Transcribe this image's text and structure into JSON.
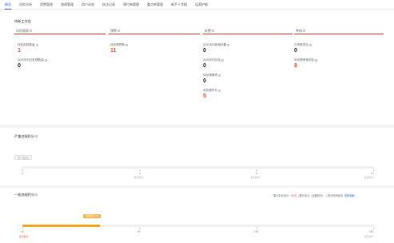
{
  "tabs": [
    "概览",
    "风险分析",
    "资费管理",
    "违规管理",
    "用户动态",
    "执法记录",
    "预付单管理",
    "重点单管理",
    "新手十字图",
    "运营护航"
  ],
  "work": {
    "title": "待新工作台",
    "columns": [
      {
        "label": "风险管理"
      },
      {
        "label": "预警"
      },
      {
        "label": "处置"
      },
      {
        "label": "考核"
      }
    ],
    "metrics": [
      {
        "label": "待处风险数量",
        "value": "1",
        "red": true
      },
      {
        "label": "近30天内已处理数量",
        "value": "0",
        "red": false
      },
      {
        "label": "待处理预警",
        "value": "11",
        "red": true
      },
      {
        "label": "近30天内新增处置",
        "value": "0",
        "red": false
      },
      {
        "label": "近30天内处结",
        "value": "0",
        "red": false
      },
      {
        "label": "待处理事项",
        "value": "0",
        "red": false
      },
      {
        "label": "待处理时长",
        "value": "5",
        "red": true
      },
      {
        "label": "已考核项目",
        "value": "0",
        "red": false
      },
      {
        "label": "待处理考核项目",
        "value": "8",
        "red": true
      }
    ]
  },
  "serious": {
    "title": "严重违规积分",
    "chip": "暂无数据",
    "ticks": [
      "0",
      "4",
      "8",
      "12"
    ],
    "tick_sub": "处罚扣分",
    "tick_sub_end": "处罚扣分"
  },
  "general": {
    "title": "一般违规积分",
    "legend_label": "累计扣分总计：",
    "legend_value": "30分",
    "legend_mid": "累计扣分（近期扣分）",
    "legend_mid2": "扣分时间在前",
    "legend_link": "查看明细",
    "tag": "当前积分 30",
    "progress": 0.22,
    "ticks": [
      "10",
      "50",
      "100",
      "150"
    ],
    "tick_sub_first": "处罚扣分",
    "tick_sub": "处罚扣分"
  },
  "colors": {
    "accent": "#2f6fe4",
    "alert": "#e84a3f",
    "progress": "#f5a623"
  }
}
